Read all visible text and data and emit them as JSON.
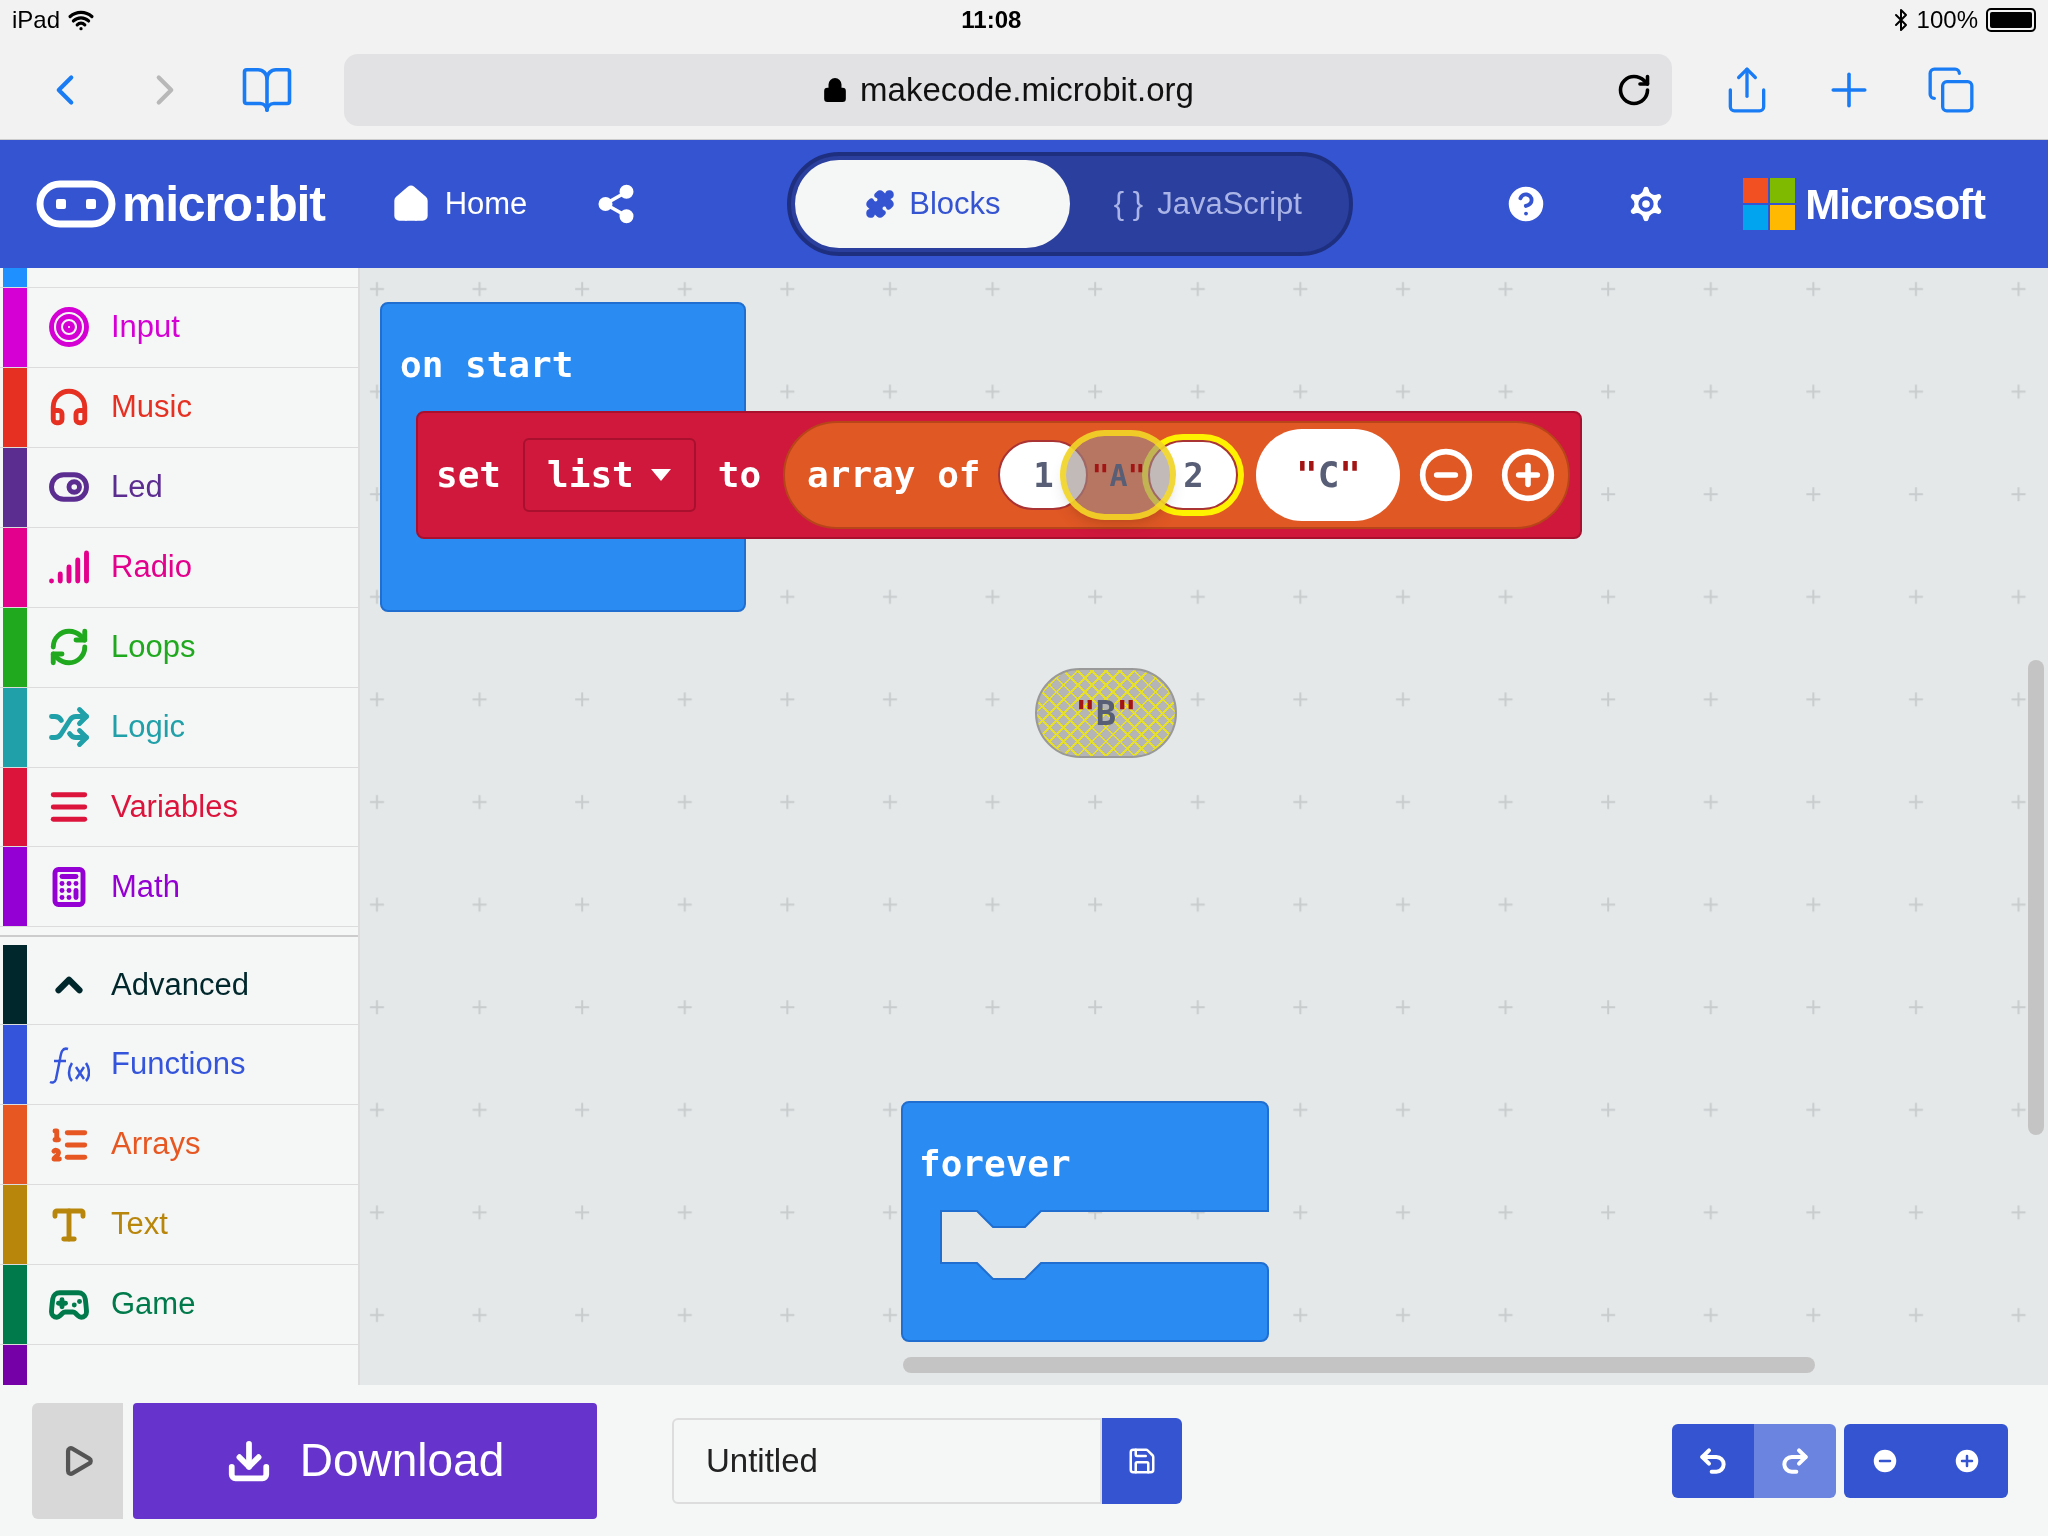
{
  "status_bar": {
    "device": "iPad",
    "time": "11:08",
    "battery": "100%"
  },
  "browser": {
    "url": "makecode.microbit.org"
  },
  "header": {
    "logo": "micro:bit",
    "home": "Home",
    "tabs": [
      {
        "label": "Blocks",
        "selected": true
      },
      {
        "label": "JavaScript",
        "icon": "{ }",
        "selected": false
      }
    ],
    "brand": "Microsoft"
  },
  "toolbox": {
    "groups": [
      [
        {
          "label": "Input",
          "kind": "input",
          "color": "#d400d4"
        },
        {
          "label": "Music",
          "kind": "music",
          "color": "#e63022"
        },
        {
          "label": "Led",
          "kind": "led",
          "color": "#5c2d91"
        },
        {
          "label": "Radio",
          "kind": "radio",
          "color": "#e3008c"
        },
        {
          "label": "Loops",
          "kind": "loops",
          "color": "#20a91f"
        },
        {
          "label": "Logic",
          "kind": "logic",
          "color": "#20a0a8"
        },
        {
          "label": "Variables",
          "kind": "variables",
          "color": "#dc143c"
        },
        {
          "label": "Math",
          "kind": "math",
          "color": "#9400d3"
        }
      ],
      [
        {
          "label": "Advanced",
          "kind": "advanced",
          "color": "#00272b",
          "expanded": true
        },
        {
          "label": "Functions",
          "kind": "functions",
          "color": "#3455db"
        },
        {
          "label": "Arrays",
          "kind": "arrays",
          "color": "#e65722"
        },
        {
          "label": "Text",
          "kind": "text",
          "color": "#b8860b"
        },
        {
          "label": "Game",
          "kind": "game",
          "color": "#007a4b"
        }
      ]
    ]
  },
  "workspace": {
    "on_start": "on start",
    "set": "set",
    "variable": "list",
    "to": "to",
    "array_of": "array of",
    "items": [
      {
        "kind": "number",
        "text": "1",
        "highlighted": false
      },
      {
        "kind": "number",
        "text": "2",
        "highlighted": true
      },
      {
        "kind": "string",
        "quote": "\"",
        "text": "C",
        "highlighted": false
      }
    ],
    "dragged": {
      "quote": "\"",
      "text": "A"
    },
    "loose": {
      "quote": "\"",
      "text": "B"
    },
    "forever": "forever"
  },
  "footer": {
    "download": "Download",
    "project_name": "Untitled"
  }
}
